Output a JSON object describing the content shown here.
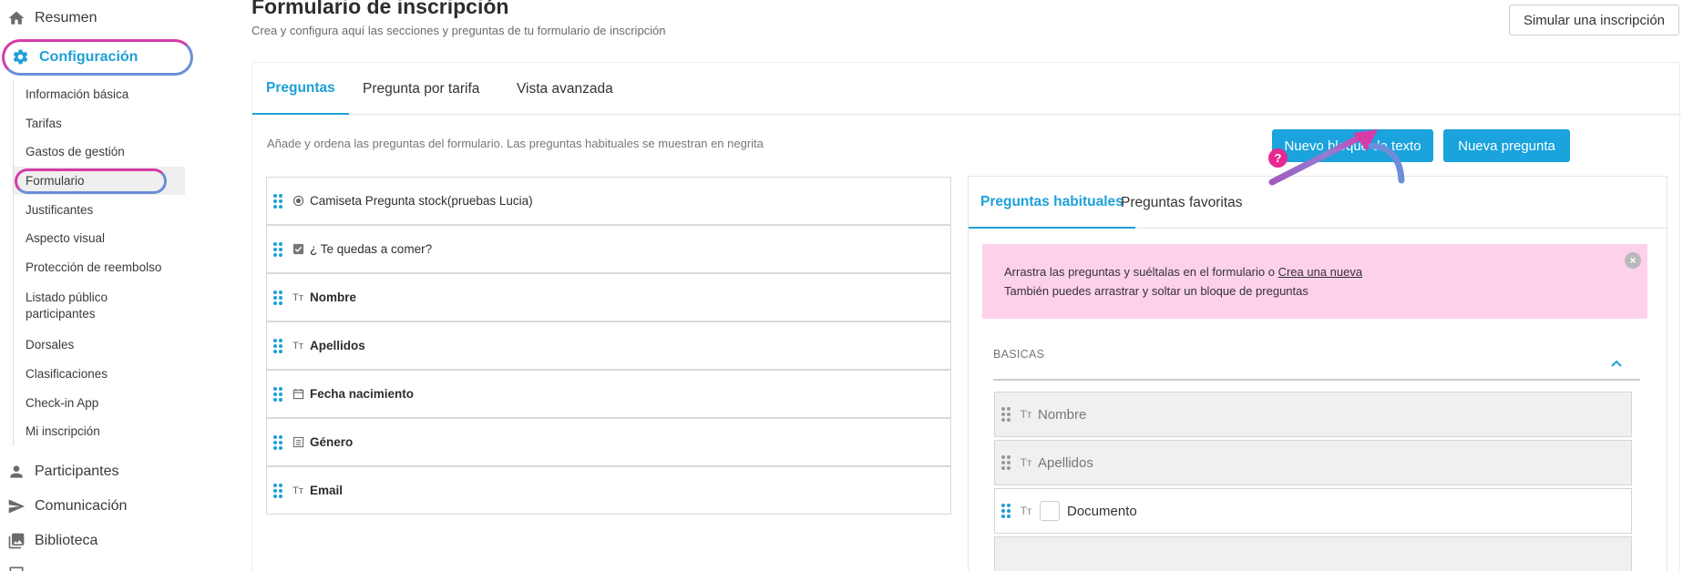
{
  "sidebar": {
    "resumen": "Resumen",
    "configuracion": "Configuración",
    "sub_items": [
      "Información básica",
      "Tarifas",
      "Gastos de gestión",
      "Formulario",
      "Justificantes",
      "Aspecto visual",
      "Protección de reembolso",
      "Listado público participantes",
      "Dorsales",
      "Clasificaciones",
      "Check-in App",
      "Mi inscripción"
    ],
    "participantes": "Participantes",
    "comunicacion": "Comunicación",
    "biblioteca": "Biblioteca"
  },
  "header": {
    "title": "Formulario de inscripción",
    "subtitle": "Crea y configura aquí las secciones y preguntas de tu formulario de inscripción",
    "simulate_button": "Simular una inscripción"
  },
  "tabs": [
    "Preguntas",
    "Pregunta por tarifa",
    "Vista avanzada"
  ],
  "hint": "Añade y ordena las preguntas del formulario. Las preguntas habituales se muestran en negrita",
  "buttons": {
    "text_block": "Nuevo bloque de texto",
    "new_question": "Nueva pregunta"
  },
  "questions": [
    {
      "label": "Camiseta Pregunta stock(pruebas Lucia)",
      "icon": "radio-icon",
      "bold": false
    },
    {
      "label": "¿ Te quedas a comer?",
      "icon": "checkbox-icon",
      "bold": false
    },
    {
      "label": "Nombre",
      "icon": "text-icon",
      "bold": true
    },
    {
      "label": "Apellidos",
      "icon": "text-icon",
      "bold": true
    },
    {
      "label": "Fecha nacimiento",
      "icon": "calendar-icon",
      "bold": true
    },
    {
      "label": "Género",
      "icon": "list-icon",
      "bold": true
    },
    {
      "label": "Email",
      "icon": "text-icon",
      "bold": true
    }
  ],
  "right_panel": {
    "tabs": [
      "Preguntas habituales",
      "Preguntas favoritas"
    ],
    "notice_line1": "Arrastra las preguntas y suéltalas en el formulario o ",
    "notice_link": "Crea una nueva",
    "notice_line2": "También puedes arrastrar y soltar un bloque de preguntas",
    "close": "×",
    "section_title": "BASICAS",
    "items": [
      "Nombre",
      "Apellidos",
      "Documento"
    ]
  },
  "annotation": {
    "question_mark": "?"
  },
  "colors": {
    "accent": "#1da0d8",
    "button": "#1aa3dd",
    "highlight_pink": "#d63ba8",
    "highlight_blue": "#6a8fd8",
    "notice_bg": "#fdd1ea"
  }
}
